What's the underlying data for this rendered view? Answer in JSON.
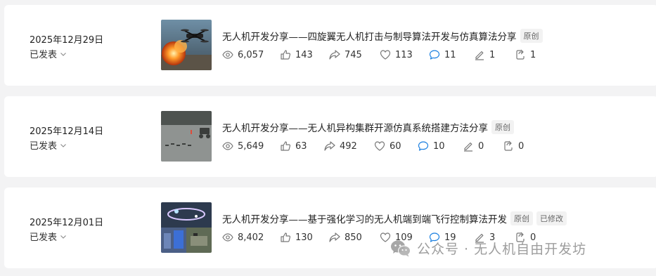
{
  "articles": [
    {
      "date": "2025年12月29日",
      "status": "已发表",
      "title": "无人机开发分享——四旋翼无人机打击与制导算法开发与仿真算法分享",
      "tags": [
        "原创"
      ],
      "stats": {
        "views": "6,057",
        "likes": "143",
        "shares": "745",
        "favorites": "113",
        "comments": "11",
        "recommends": "1",
        "forwards": "1"
      }
    },
    {
      "date": "2025年12月14日",
      "status": "已发表",
      "title": "无人机开发分享——无人机异构集群开源仿真系统搭建方法分享",
      "tags": [
        "原创"
      ],
      "stats": {
        "views": "5,649",
        "likes": "63",
        "shares": "492",
        "favorites": "60",
        "comments": "10",
        "recommends": "0",
        "forwards": "0"
      }
    },
    {
      "date": "2025年12月01日",
      "status": "已发表",
      "title": "无人机开发分享——基于强化学习的无人机端到端飞行控制算法开发",
      "tags": [
        "原创",
        "已修改"
      ],
      "stats": {
        "views": "8,402",
        "likes": "130",
        "shares": "850",
        "favorites": "109",
        "comments": "19",
        "recommends": "3",
        "forwards": "0"
      }
    }
  ],
  "watermark": {
    "text": "公众号 · 无人机自由开发坊",
    "icon": "wechat-icon"
  },
  "icons": {
    "views": "eye-icon",
    "likes": "thumbs-up-icon",
    "shares": "share-arrow-icon",
    "favorites": "heart-icon",
    "comments": "comment-bubble-icon",
    "recommends": "pen-icon",
    "forwards": "forward-icon",
    "status": "chevron-down-icon"
  },
  "colors": {
    "background": "#f3f3f4",
    "card": "#ffffff",
    "icon": "#777777",
    "tag_bg": "#f2f2f2"
  }
}
